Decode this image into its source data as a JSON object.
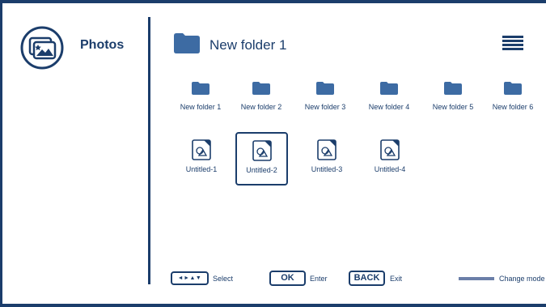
{
  "sidebar": {
    "app_name": "Photos",
    "icon": "photos-icon"
  },
  "header": {
    "title": "New folder 1",
    "folder_icon": "folder-icon",
    "menu_icon": "menu-icon"
  },
  "folders": [
    {
      "label": "New folder 1"
    },
    {
      "label": "New folder 2"
    },
    {
      "label": "New folder 3"
    },
    {
      "label": "New folder 4"
    },
    {
      "label": "New folder 5"
    },
    {
      "label": "New folder 6"
    }
  ],
  "files": [
    {
      "label": "Untitled-1",
      "selected": false
    },
    {
      "label": "Untitled-2",
      "selected": true
    },
    {
      "label": "Untitled-3",
      "selected": false
    },
    {
      "label": "Untitled-4",
      "selected": false
    }
  ],
  "footer": {
    "nav_key": "◄►▲▼",
    "nav_label": "Select",
    "ok_key": "OK",
    "ok_label": "Enter",
    "back_key": "BACK",
    "back_label": "Exit",
    "mode_label": "Change mode"
  },
  "colors": {
    "accent": "#1b3d6b",
    "folder": "#3d6ba3"
  }
}
